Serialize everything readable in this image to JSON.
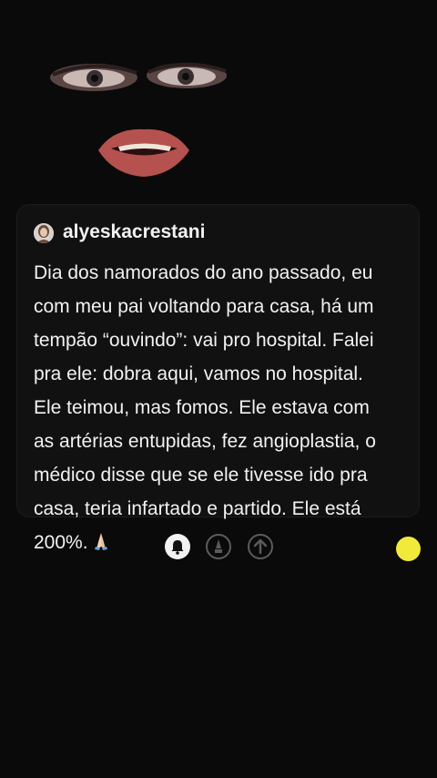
{
  "comment": {
    "username": "alyeskacrestani",
    "text": "Dia dos namorados do ano passado, eu\ncom meu pai voltando para casa, há um\ntempão “ouvindo”: vai pro hospital. Falei\npra ele: dobra aqui, vamos no hospital.\nEle teimou, mas fomos. Ele estava com\nas artérias entupidas, fez angioplastia, o\nmédico disse que se ele tivesse ido pra\ncasa, teria infartado e partido. Ele está\n200%.",
    "emoji_icon": "praying-hands-icon"
  },
  "actions": [
    {
      "icon": "bell-icon"
    },
    {
      "icon": "pen-icon"
    },
    {
      "icon": "arrow-up-icon"
    }
  ],
  "colors": {
    "background": "#0a0a0a",
    "card": "#111111",
    "text": "#f2f2f2",
    "indicator": "#f2ea3a"
  }
}
